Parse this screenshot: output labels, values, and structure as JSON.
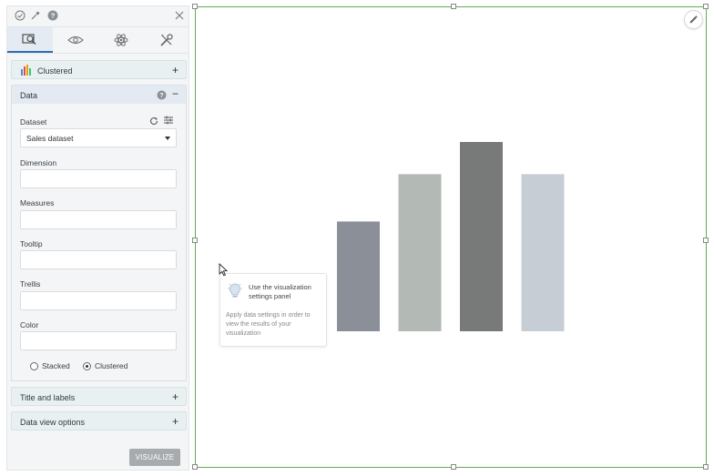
{
  "panel": {
    "tabs": [
      {
        "name": "tab-data",
        "icon": "search-data-icon",
        "active": true
      },
      {
        "name": "tab-preview",
        "icon": "eye-icon",
        "active": false
      },
      {
        "name": "tab-advanced",
        "icon": "atom-icon",
        "active": false
      },
      {
        "name": "tab-tools",
        "icon": "tools-icon",
        "active": false
      }
    ],
    "chart_type_label": "Clustered",
    "data_section": {
      "title": "Data",
      "dataset_label": "Dataset",
      "dataset_value": "Sales dataset",
      "dimension_label": "Dimension",
      "measures_label": "Measures",
      "tooltip_label": "Tooltip",
      "trellis_label": "Trellis",
      "color_label": "Color",
      "radio_stacked": "Stacked",
      "radio_clustered": "Clustered",
      "selected_mode": "Clustered"
    },
    "title_labels_section": "Title and labels",
    "data_view_section": "Data view options",
    "visualize_label": "VISUALIZE"
  },
  "hint": {
    "title": "Use the visualization settings panel",
    "description": "Apply data settings in order to view the results of your visualization"
  },
  "colors": {
    "selection_border": "#5bb04d",
    "active_tab": "#2d6db2",
    "bars": [
      "#8b8f98",
      "#b3b9b5",
      "#777a78",
      "#c7cdd5"
    ]
  },
  "chart_data": {
    "type": "bar",
    "categories": [
      "",
      "",
      "",
      ""
    ],
    "values": [
      58,
      83,
      100,
      83
    ],
    "title": "",
    "xlabel": "",
    "ylabel": "",
    "ylim": [
      0,
      100
    ],
    "grid": false
  }
}
